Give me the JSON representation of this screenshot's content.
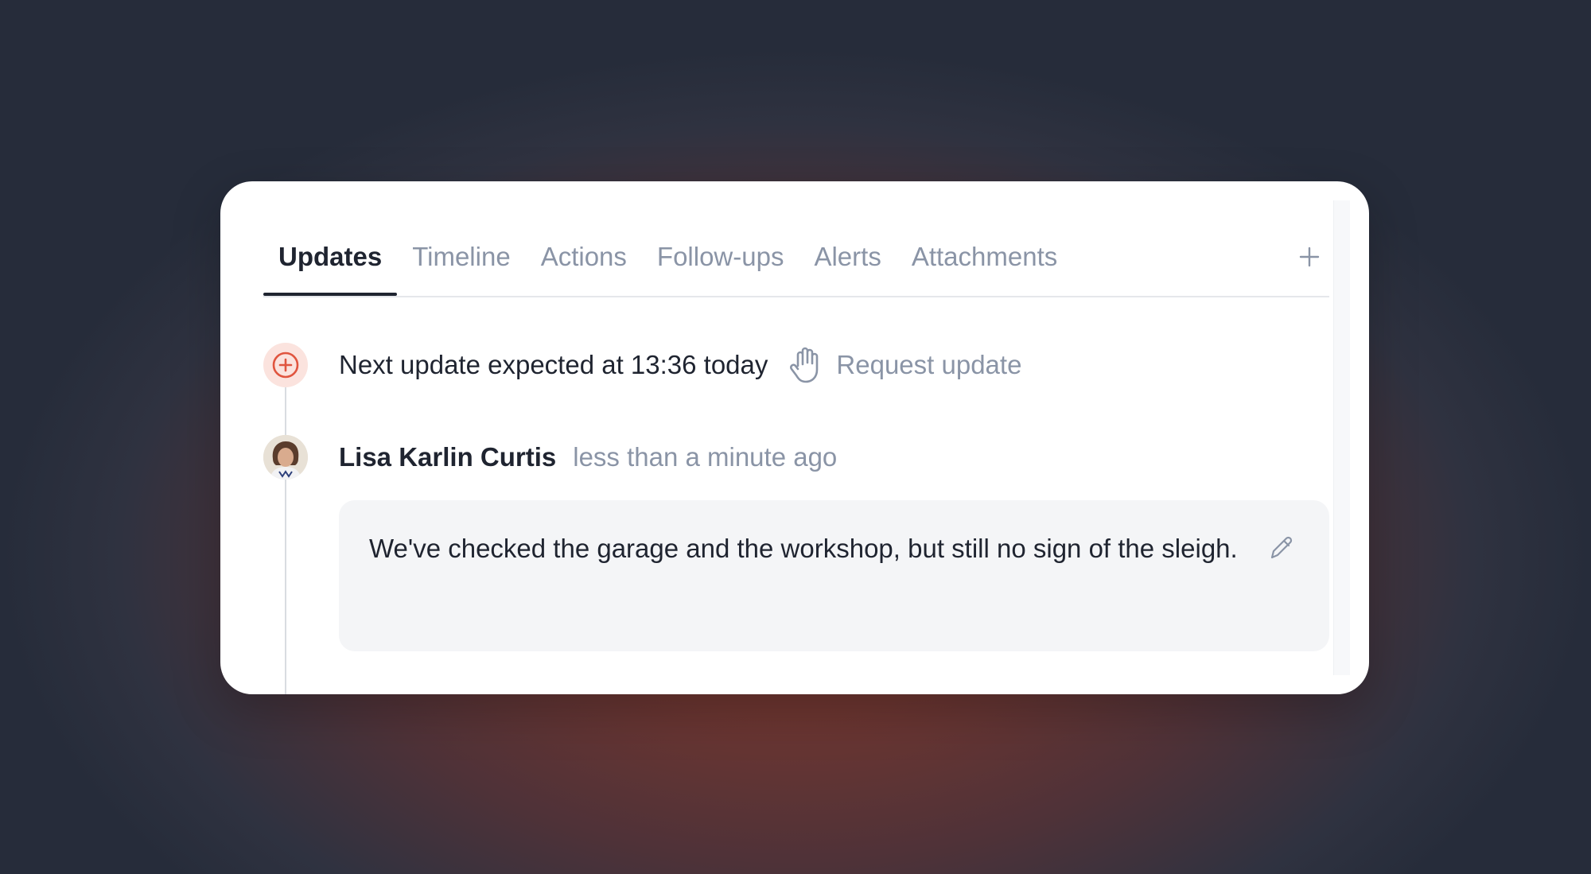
{
  "tabs": [
    {
      "label": "Updates",
      "active": true
    },
    {
      "label": "Timeline",
      "active": false
    },
    {
      "label": "Actions",
      "active": false
    },
    {
      "label": "Follow-ups",
      "active": false
    },
    {
      "label": "Alerts",
      "active": false
    },
    {
      "label": "Attachments",
      "active": false
    }
  ],
  "add_tab_icon": "plus-icon",
  "next_update": {
    "icon": "plus-circle-icon",
    "text": "Next update expected at 13:36 today",
    "request_icon": "hand-icon",
    "request_label": "Request update"
  },
  "update": {
    "author": "Lisa Karlin Curtis",
    "time": "less than a minute ago",
    "message": "We've checked the garage and the workshop, but still no sign of the sleigh.",
    "edit_icon": "pencil-icon"
  },
  "colors": {
    "accent": "#e0553f",
    "accent_bg": "#fbe3de",
    "text_primary": "#1f2430",
    "text_muted": "#8a94a6",
    "message_bg": "#f4f5f7"
  }
}
